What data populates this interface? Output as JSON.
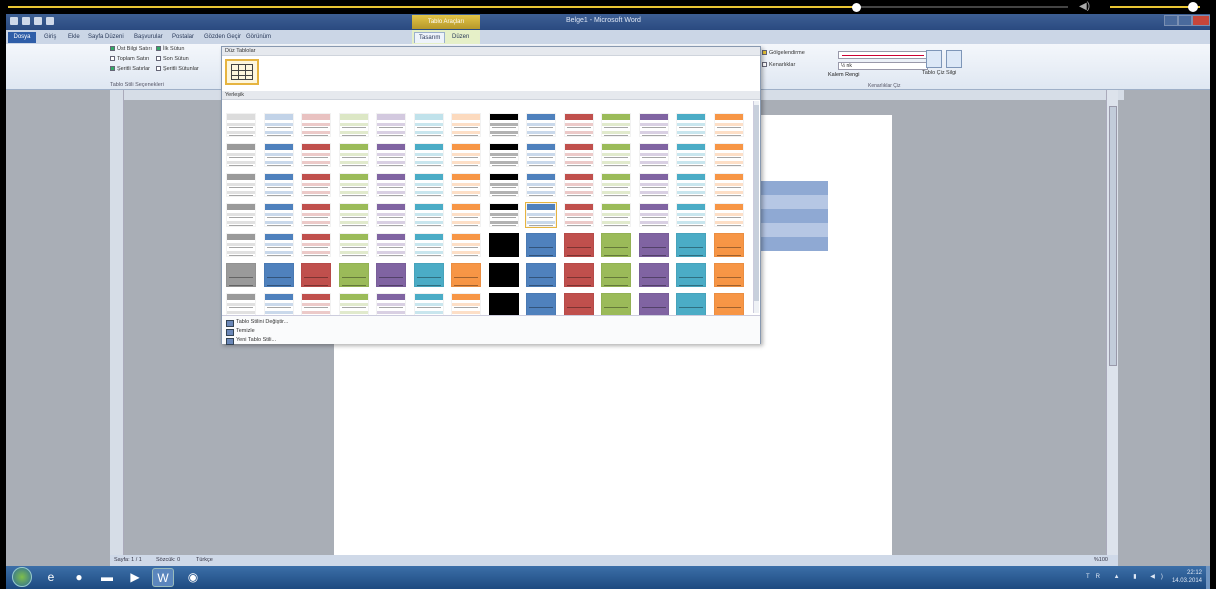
{
  "player": {
    "progress": 0.8,
    "volume": 0.9,
    "volume_icon": "volume-icon"
  },
  "window": {
    "title": "Belge1 - Microsoft Word",
    "context_tab_title": "Tablo Araçları"
  },
  "ribbon_tabs": [
    {
      "label": "Dosya"
    },
    {
      "label": "Giriş"
    },
    {
      "label": "Ekle"
    },
    {
      "label": "Sayfa Düzeni"
    },
    {
      "label": "Başvurular"
    },
    {
      "label": "Postalar"
    },
    {
      "label": "Gözden Geçir"
    },
    {
      "label": "Görünüm"
    },
    {
      "label": "Tasarım"
    },
    {
      "label": "Düzen"
    }
  ],
  "options": {
    "header_row": "Üst Bilgi Satırı",
    "first_column": "İlk Sütun",
    "total_row": "Toplam Satırı",
    "last_column": "Son Sütun",
    "banded_rows": "Şeritli Satırlar",
    "banded_columns": "Şeritli Sütunlar",
    "group_label": "Tablo Stili Seçenekleri"
  },
  "borders": {
    "shading": "Gölgelendirme",
    "borders": "Kenarlıklar",
    "pen_width": "½ nk",
    "pen_color": "Kalem Rengi",
    "draw_table": "Tablo Çiz",
    "eraser": "Silgi",
    "group_label": "Kenarlıklar Çiz"
  },
  "gallery": {
    "plain_header": "Düz Tablolar",
    "builtin_header": "Yerleşik",
    "footer": [
      {
        "label": "Tablo Stilini Değiştir..."
      },
      {
        "label": "Temizle"
      },
      {
        "label": "Yeni Tablo Stili..."
      }
    ],
    "style_colors": [
      "#9a9a9a",
      "#4f81bd",
      "#c0504d",
      "#9bbb59",
      "#8064a2",
      "#4bacc6",
      "#f79646",
      "#000000",
      "#4f81bd",
      "#c0504d",
      "#9bbb59",
      "#8064a2",
      "#4bacc6",
      "#f79646"
    ],
    "hovered_style": {
      "row": 3,
      "col": 8
    }
  },
  "status_bar": {
    "page": "Sayfa: 1 / 1",
    "words": "Sözcük: 0",
    "language": "Türkçe",
    "zoom": "%100"
  },
  "taskbar": {
    "apps": [
      "ie-icon",
      "chrome-icon",
      "explorer-icon",
      "media-icon",
      "word-icon",
      "app-icon"
    ],
    "time": "22:12",
    "date": "14.03.2014",
    "lang": "TR"
  }
}
